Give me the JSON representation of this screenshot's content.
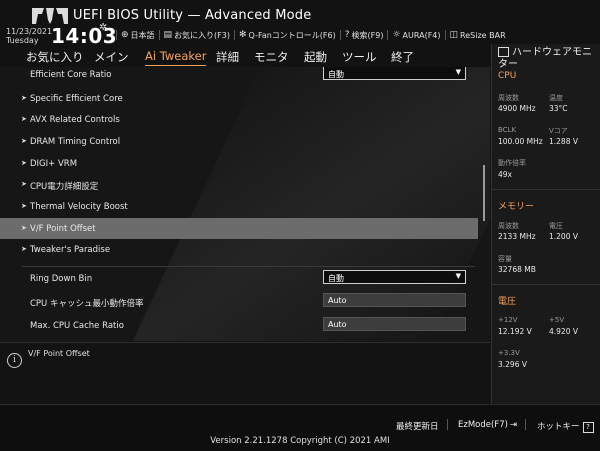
{
  "header": {
    "title": "UEFI BIOS Utility — Advanced Mode",
    "date": "11/23/2021",
    "day": "Tuesday",
    "time": "14:03",
    "toolbar": [
      {
        "icon": "globe-icon",
        "label": "日本語"
      },
      {
        "icon": "favorites-icon",
        "label": "お気に入り(F3)"
      },
      {
        "icon": "fan-icon",
        "label": "Q-Fanコントロール(F6)"
      },
      {
        "icon": "search-icon",
        "label": "検索(F9)"
      },
      {
        "icon": "aura-icon",
        "label": "AURA(F4)"
      },
      {
        "icon": "resize-bar-icon",
        "label": "ReSize BAR"
      }
    ]
  },
  "menu": {
    "items": [
      "お気に入り",
      "メイン",
      "Ai Tweaker",
      "詳細",
      "モニタ",
      "起動",
      "ツール",
      "終了"
    ],
    "active": "Ai Tweaker"
  },
  "settings": {
    "efficient_core_ratio": {
      "label": "Efficient Core Ratio",
      "value": "自動"
    },
    "submenus": [
      "Specific Efficient Core",
      "AVX Related Controls",
      "DRAM Timing Control",
      "DIGI+ VRM",
      "CPU電力詳細設定",
      "Thermal Velocity Boost",
      "V/F Point Offset",
      "Tweaker's Paradise"
    ],
    "selected": "V/F Point Offset",
    "ring_down_bin": {
      "label": "Ring Down Bin",
      "value": "自動"
    },
    "cache_min_ratio": {
      "label": "CPU キャッシュ最小動作倍率",
      "value": "Auto"
    },
    "cache_max_ratio": {
      "label": "Max. CPU Cache Ratio",
      "value": "Auto"
    }
  },
  "help": {
    "text": "V/F Point Offset"
  },
  "hardware_monitor": {
    "title": "ハードウェアモニター",
    "cpu": {
      "section": "CPU",
      "freq_label": "周波数",
      "freq_value": "4900 MHz",
      "temp_label": "温度",
      "temp_value": "33°C",
      "bclk_label": "BCLK",
      "bclk_value": "100.00 MHz",
      "vcore_label": "Vコア",
      "vcore_value": "1.288 V",
      "ratio_label": "動作倍率",
      "ratio_value": "49x"
    },
    "memory": {
      "section": "メモリー",
      "freq_label": "周波数",
      "freq_value": "2133 MHz",
      "volt_label": "電圧",
      "volt_value": "1.200 V",
      "cap_label": "容量",
      "cap_value": "32768 MB"
    },
    "voltage": {
      "section": "電圧",
      "v12_label": "+12V",
      "v12_value": "12.192 V",
      "v5_label": "+5V",
      "v5_value": "4.920 V",
      "v33_label": "+3.3V",
      "v33_value": "3.296 V"
    }
  },
  "footer": {
    "last_modified": "最終更新日",
    "ezmode": "EzMode(F7)",
    "hotkeys": "ホットキー",
    "version": "Version 2.21.1278 Copyright (C) 2021 AMI"
  },
  "colors": {
    "accent": "#f5a35e",
    "selected_row": "#6c6c6c",
    "background": "#141414"
  }
}
